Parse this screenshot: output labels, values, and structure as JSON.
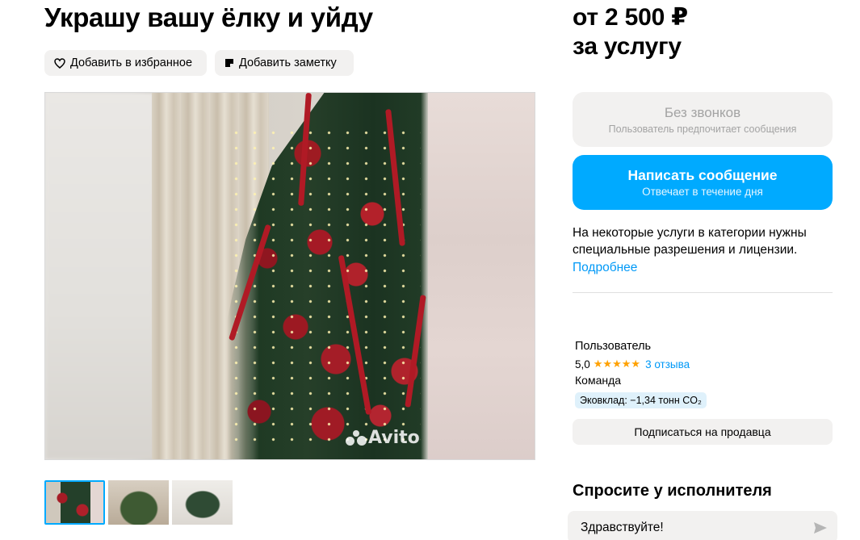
{
  "listing": {
    "title": "Украшу вашу ёлку и уйду",
    "favorite_label": "Добавить в избранное",
    "note_label": "Добавить заметку",
    "photo_watermark": "Avito",
    "thumbnail_count": 3
  },
  "pricing": {
    "price": "от 2 500 ₽",
    "unit": "за услугу"
  },
  "contact": {
    "no_calls_title": "Без звонков",
    "no_calls_subtitle": "Пользователь предпочитает сообщения",
    "message_title": "Написать сообщение",
    "message_subtitle": "Отвечает в течение дня"
  },
  "notice": {
    "text": "На некоторые услуги в категории нужны специальные разрешения и лицензии.",
    "link": "Подробнее"
  },
  "seller": {
    "name": "Пользователь",
    "rating": "5,0",
    "stars": "★★★★★",
    "reviews": "3 отзыва",
    "type": "Команда",
    "eco_badge": "Эковклад: −1,34 тонн CO₂",
    "subscribe_label": "Подписаться на продавца"
  },
  "ask": {
    "title": "Спросите у исполнителя",
    "input_value": "Здравствуйте!"
  },
  "colors": {
    "accent": "#00aaff",
    "link": "#0099f7",
    "star": "#ffa100",
    "button_bg": "#f2f1f0"
  }
}
